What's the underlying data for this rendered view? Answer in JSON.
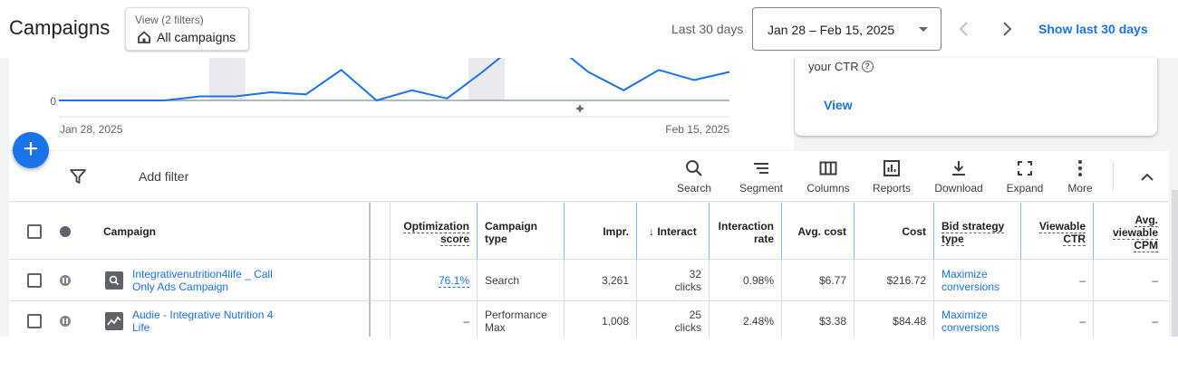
{
  "header": {
    "title": "Campaigns",
    "view_subtitle": "View (2 filters)",
    "view_label": "All campaigns",
    "range_label": "Last 30 days",
    "date_range": "Jan 28 – Feb 15, 2025",
    "show_last": "Show last 30 days"
  },
  "chart": {
    "y_zero_label": "0",
    "x_start_label": "Jan 28, 2025",
    "x_end_label": "Feb 15, 2025",
    "line_color": "#1a73e8"
  },
  "chart_data": {
    "type": "line",
    "x": [
      "Jan 28",
      "Jan 29",
      "Jan 30",
      "Jan 31",
      "Feb 1",
      "Feb 2",
      "Feb 3",
      "Feb 4",
      "Feb 5",
      "Feb 6",
      "Feb 7",
      "Feb 8",
      "Feb 9",
      "Feb 10",
      "Feb 11",
      "Feb 12",
      "Feb 13",
      "Feb 14",
      "Feb 15"
    ],
    "values": [
      0,
      0,
      0,
      0,
      1,
      1,
      2,
      1.5,
      7.5,
      0,
      2.5,
      0.5,
      7,
      14,
      14,
      7,
      2.5,
      7.5,
      5,
      7
    ],
    "ylim_visible": [
      0,
      10
    ],
    "xlabel": "",
    "ylabel": ""
  },
  "insight": {
    "text": "your CTR",
    "link": "View"
  },
  "toolbar": {
    "add_filter": "Add filter",
    "tools": [
      {
        "label": "Search",
        "icon": "search-icon"
      },
      {
        "label": "Segment",
        "icon": "segment-icon"
      },
      {
        "label": "Columns",
        "icon": "columns-icon"
      },
      {
        "label": "Reports",
        "icon": "reports-icon"
      },
      {
        "label": "Download",
        "icon": "download-icon"
      },
      {
        "label": "Expand",
        "icon": "expand-icon"
      },
      {
        "label": "More",
        "icon": "more-icon"
      }
    ]
  },
  "table": {
    "headers": {
      "campaign": "Campaign",
      "opt_score_1": "Optimization",
      "opt_score_2": "score",
      "camp_type_1": "Campaign",
      "camp_type_2": "type",
      "impr": "Impr.",
      "interactions": "Interact",
      "int_rate_1": "Interaction",
      "int_rate_2": "rate",
      "avg_cost": "Avg. cost",
      "cost": "Cost",
      "bid_1": "Bid strategy",
      "bid_2": "type",
      "vctr_1": "Viewable",
      "vctr_2": "CTR",
      "vcpm_1": "Avg.",
      "vcpm_2": "viewable",
      "vcpm_3": "CPM"
    },
    "rows": [
      {
        "name_1": "Integrativenutrition4life _ Call",
        "name_2": "Only Ads Campaign",
        "opt_score": "76.1%",
        "type_1": "Search",
        "type_2": "",
        "impr": "3,261",
        "int_1": "32",
        "int_2": "clicks",
        "int_rate": "0.98%",
        "avg_cost": "$6.77",
        "cost": "$216.72",
        "bid_1": "Maximize",
        "bid_2": "conversions",
        "vctr": "–",
        "vcpm": "–",
        "type_icon": "search-campaign-icon"
      },
      {
        "name_1": "Audie - Integrative Nutrition 4",
        "name_2": "Life",
        "opt_score": "–",
        "type_1": "Performance",
        "type_2": "Max",
        "impr": "1,008",
        "int_1": "25",
        "int_2": "clicks",
        "int_rate": "2.48%",
        "avg_cost": "$3.38",
        "cost": "$84.48",
        "bid_1": "Maximize",
        "bid_2": "conversions",
        "vctr": "–",
        "vcpm": "–",
        "type_icon": "performance-max-icon"
      }
    ]
  }
}
